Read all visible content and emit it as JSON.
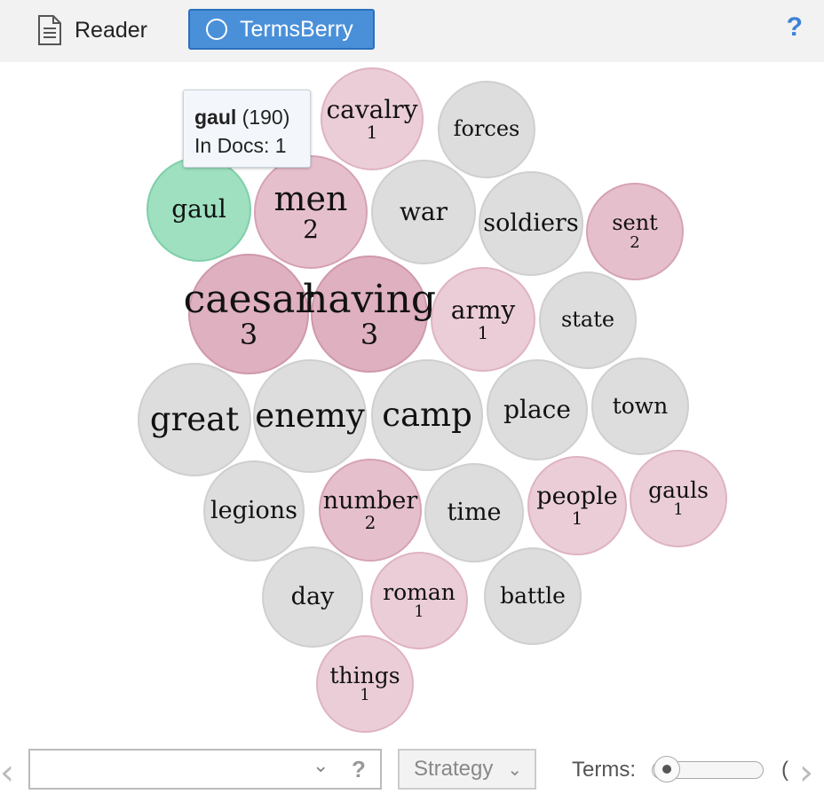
{
  "header": {
    "reader_label": "Reader",
    "termsberry_label": "TermsBerry",
    "help": "?"
  },
  "colors": {
    "gray": "#dddddd",
    "pink_light": "#ebcdd8",
    "pink_dark": "#ddb0c0",
    "green": "#9ee0c0"
  },
  "tooltip": {
    "term": "gaul",
    "count": "(190)",
    "docs": "In Docs: 1"
  },
  "terms": [
    {
      "label": "cavalry",
      "count": "1",
      "color": "#ebcdd8",
      "border": "#dfb3c3"
    },
    {
      "label": "forces",
      "count": "",
      "color": "#dddddd",
      "border": "#cfcfcf"
    },
    {
      "label": "gaul",
      "count": "",
      "color": "#9ee0c0",
      "border": "#7fcfaa"
    },
    {
      "label": "men",
      "count": "2",
      "color": "#e6bfcd",
      "border": "#d5a2b4"
    },
    {
      "label": "war",
      "count": "",
      "color": "#dddddd",
      "border": "#cfcfcf"
    },
    {
      "label": "soldiers",
      "count": "",
      "color": "#dddddd",
      "border": "#cfcfcf"
    },
    {
      "label": "sent",
      "count": "2",
      "color": "#e6bfcd",
      "border": "#d5a2b4"
    },
    {
      "label": "caesar",
      "count": "3",
      "color": "#deb0c0",
      "border": "#cf98ab"
    },
    {
      "label": "having",
      "count": "3",
      "color": "#deb0c0",
      "border": "#cf98ab"
    },
    {
      "label": "army",
      "count": "1",
      "color": "#ebcdd8",
      "border": "#dfb3c3"
    },
    {
      "label": "state",
      "count": "",
      "color": "#dddddd",
      "border": "#cfcfcf"
    },
    {
      "label": "great",
      "count": "",
      "color": "#dddddd",
      "border": "#cfcfcf"
    },
    {
      "label": "enemy",
      "count": "",
      "color": "#dddddd",
      "border": "#cfcfcf"
    },
    {
      "label": "camp",
      "count": "",
      "color": "#dddddd",
      "border": "#cfcfcf"
    },
    {
      "label": "place",
      "count": "",
      "color": "#dddddd",
      "border": "#cfcfcf"
    },
    {
      "label": "town",
      "count": "",
      "color": "#dddddd",
      "border": "#cfcfcf"
    },
    {
      "label": "legions",
      "count": "",
      "color": "#dddddd",
      "border": "#cfcfcf"
    },
    {
      "label": "number",
      "count": "2",
      "color": "#e6bfcd",
      "border": "#d5a2b4"
    },
    {
      "label": "time",
      "count": "",
      "color": "#dddddd",
      "border": "#cfcfcf"
    },
    {
      "label": "people",
      "count": "1",
      "color": "#ebcdd8",
      "border": "#dfb3c3"
    },
    {
      "label": "gauls",
      "count": "1",
      "color": "#ebcdd8",
      "border": "#dfb3c3"
    },
    {
      "label": "day",
      "count": "",
      "color": "#dddddd",
      "border": "#cfcfcf"
    },
    {
      "label": "roman",
      "count": "1",
      "color": "#ebcdd8",
      "border": "#dfb3c3"
    },
    {
      "label": "battle",
      "count": "",
      "color": "#dddddd",
      "border": "#cfcfcf"
    },
    {
      "label": "things",
      "count": "1",
      "color": "#ebcdd8",
      "border": "#dfb3c3"
    }
  ],
  "toolbar": {
    "strategy_label": "Strategy",
    "terms_label": "Terms:",
    "combo_help": "?",
    "paren": "("
  }
}
